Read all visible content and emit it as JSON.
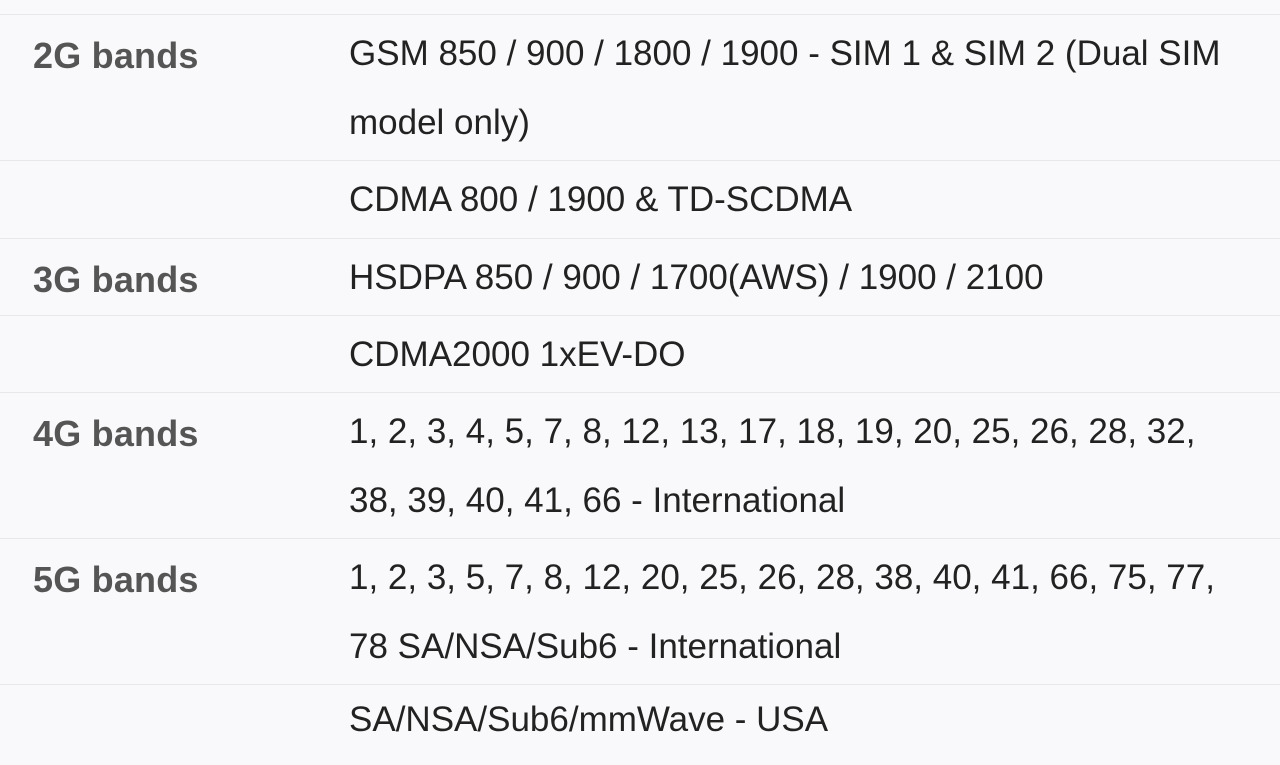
{
  "specs": [
    {
      "label": "2G bands",
      "value": "GSM 850 / 900 / 1800 / 1900 - SIM 1 & SIM 2 (Dual SIM model only)"
    },
    {
      "label": "",
      "value": "CDMA 800 / 1900 & TD-SCDMA"
    },
    {
      "label": "3G bands",
      "value": "HSDPA 850 / 900 / 1700(AWS) / 1900 / 2100"
    },
    {
      "label": "",
      "value": "CDMA2000 1xEV-DO"
    },
    {
      "label": "4G bands",
      "value": "1, 2, 3, 4, 5, 7, 8, 12, 13, 17, 18, 19, 20, 25, 26, 28, 32, 38, 39, 40, 41, 66 - International"
    },
    {
      "label": "5G bands",
      "value": "1, 2, 3, 5, 7, 8, 12, 20, 25, 26, 28, 38, 40, 41, 66, 75, 77, 78 SA/NSA/Sub6 - International"
    },
    {
      "label": "",
      "value": "SA/NSA/Sub6/mmWave - USA"
    }
  ]
}
